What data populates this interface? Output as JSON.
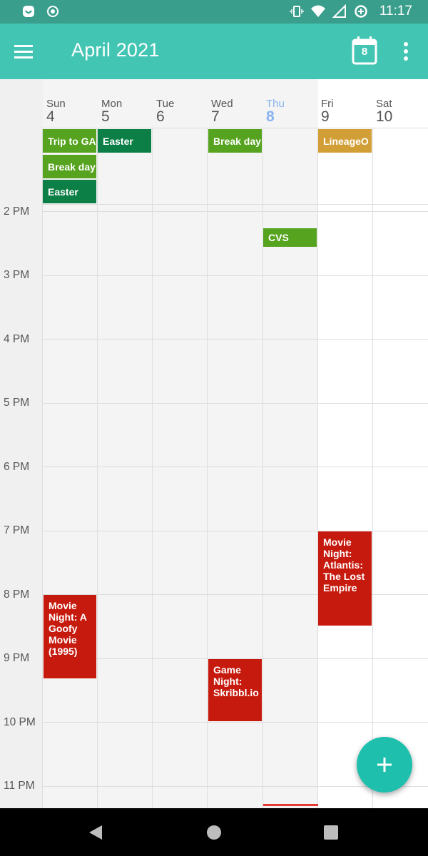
{
  "status_bar": {
    "time": "11:17",
    "icons": [
      "assistant-icon",
      "record-icon",
      "vibrate-icon",
      "wifi-icon",
      "signal-icon",
      "data-saver-icon"
    ]
  },
  "app_bar": {
    "title": "April 2021",
    "today_badge": "8",
    "icons": [
      "menu-icon",
      "calendar-today-icon",
      "more-vert-icon"
    ]
  },
  "week": {
    "days": [
      {
        "name": "Sun",
        "num": "4",
        "today": false
      },
      {
        "name": "Mon",
        "num": "5",
        "today": false
      },
      {
        "name": "Tue",
        "num": "6",
        "today": false
      },
      {
        "name": "Wed",
        "num": "7",
        "today": false
      },
      {
        "name": "Thu",
        "num": "8",
        "today": true
      },
      {
        "name": "Fri",
        "num": "9",
        "today": false
      },
      {
        "name": "Sat",
        "num": "10",
        "today": false
      }
    ],
    "hours": [
      "2 PM",
      "3 PM",
      "4 PM",
      "5 PM",
      "6 PM",
      "7 PM",
      "8 PM",
      "9 PM",
      "10 PM",
      "11 PM"
    ]
  },
  "all_day_events": [
    {
      "label": "Trip to GA",
      "color": "#55a31e"
    },
    {
      "label": "Break day",
      "color": "#55a31e"
    },
    {
      "label": "Easter",
      "color": "#0b7f45"
    },
    {
      "label": "Easter",
      "color": "#0b7f45"
    },
    {
      "label": "Break day",
      "color": "#55a31e"
    },
    {
      "label": "LineageO",
      "color": "#d29f37"
    }
  ],
  "events": [
    {
      "label": "CVS",
      "color": "#55a31e"
    },
    {
      "label": "Movie Night: Atlantis: The Lost Empire",
      "color": "#c71a0e"
    },
    {
      "label": "Movie Night: A Goofy Movie (1995)",
      "color": "#c71a0e"
    },
    {
      "label": "Game Night: Skribbl.io",
      "color": "#c71a0e"
    }
  ],
  "colors": {
    "status_bar": "#3a9e8d",
    "app_bar": "#43c5b4",
    "fab": "#1fbfad",
    "today_text": "#8ab4f0",
    "now_line": "#e53935"
  },
  "fab": {
    "icon": "plus-icon"
  },
  "nav_bar": {
    "icons": [
      "back-icon",
      "home-icon",
      "recents-icon"
    ]
  }
}
